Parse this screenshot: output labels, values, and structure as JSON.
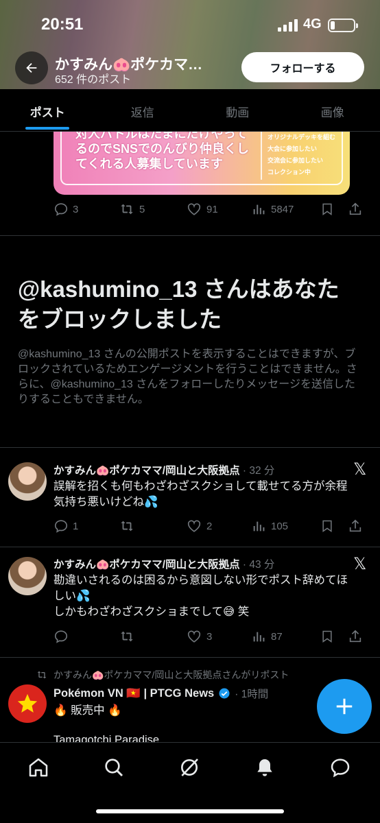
{
  "status_bar": {
    "time": "20:51",
    "network": "4G"
  },
  "header": {
    "title": "かすみん🐽ポケカマ…",
    "post_count": "652 件のポスト",
    "follow_label": "フォローする"
  },
  "tabs": [
    {
      "label": "ポスト"
    },
    {
      "label": "返信"
    },
    {
      "label": "動画"
    },
    {
      "label": "画像"
    }
  ],
  "image_card": {
    "text_lines": [
      "対人バトルはたまにだけやって",
      "るのでSNSでのんびり仲良くし",
      "てくれる人募集しています"
    ],
    "list": [
      "オリジナルデッキを組む",
      "大会に参加したい",
      "交流会に参加したい",
      "コレクション中"
    ]
  },
  "post0": {
    "replies": "3",
    "reposts": "5",
    "likes": "91",
    "views": "5847"
  },
  "blocked": {
    "title": "@kashumino_13 さんはあなたをブロックしました",
    "description": "@kashumino_13 さんの公開ポストを表示することはできますが、ブロックされているためエンゲージメントを行うことはできません。さらに、@kashumino_13 さんをフォローしたりメッセージを送信したりすることもできません。"
  },
  "posts": [
    {
      "name": "かすみん🐽ポケカママ/岡山と大阪拠点",
      "time": "· 32 分",
      "body": [
        "誤解を招くも何もわざわざスクショして載せてる方が余程",
        "気持ち悪いけどね💦"
      ],
      "replies": "1",
      "reposts": "",
      "likes": "2",
      "views": "105"
    },
    {
      "name": "かすみん🐽ポケカママ/岡山と大阪拠点",
      "time": "· 43 分",
      "body": [
        "勘違いされるのは困るから意図しない形でポスト辞めてほ",
        "しい💦",
        "しかもわざわざスクショまでして😅 笑"
      ],
      "replies": "",
      "reposts": "",
      "likes": "3",
      "views": "87"
    }
  ],
  "repost": {
    "label": "かすみん🐽ポケカママ/岡山と大阪拠点さんがリポスト",
    "name": "Pokémon VN 🇻🇳 | PTCG News",
    "time": "· 1時間",
    "body": "🔥 販売中 🔥",
    "cut_text": "Tamagotchi Paradise"
  },
  "colors": {
    "accent": "#1d9bf0",
    "muted": "#71767b",
    "background": "#000000"
  }
}
